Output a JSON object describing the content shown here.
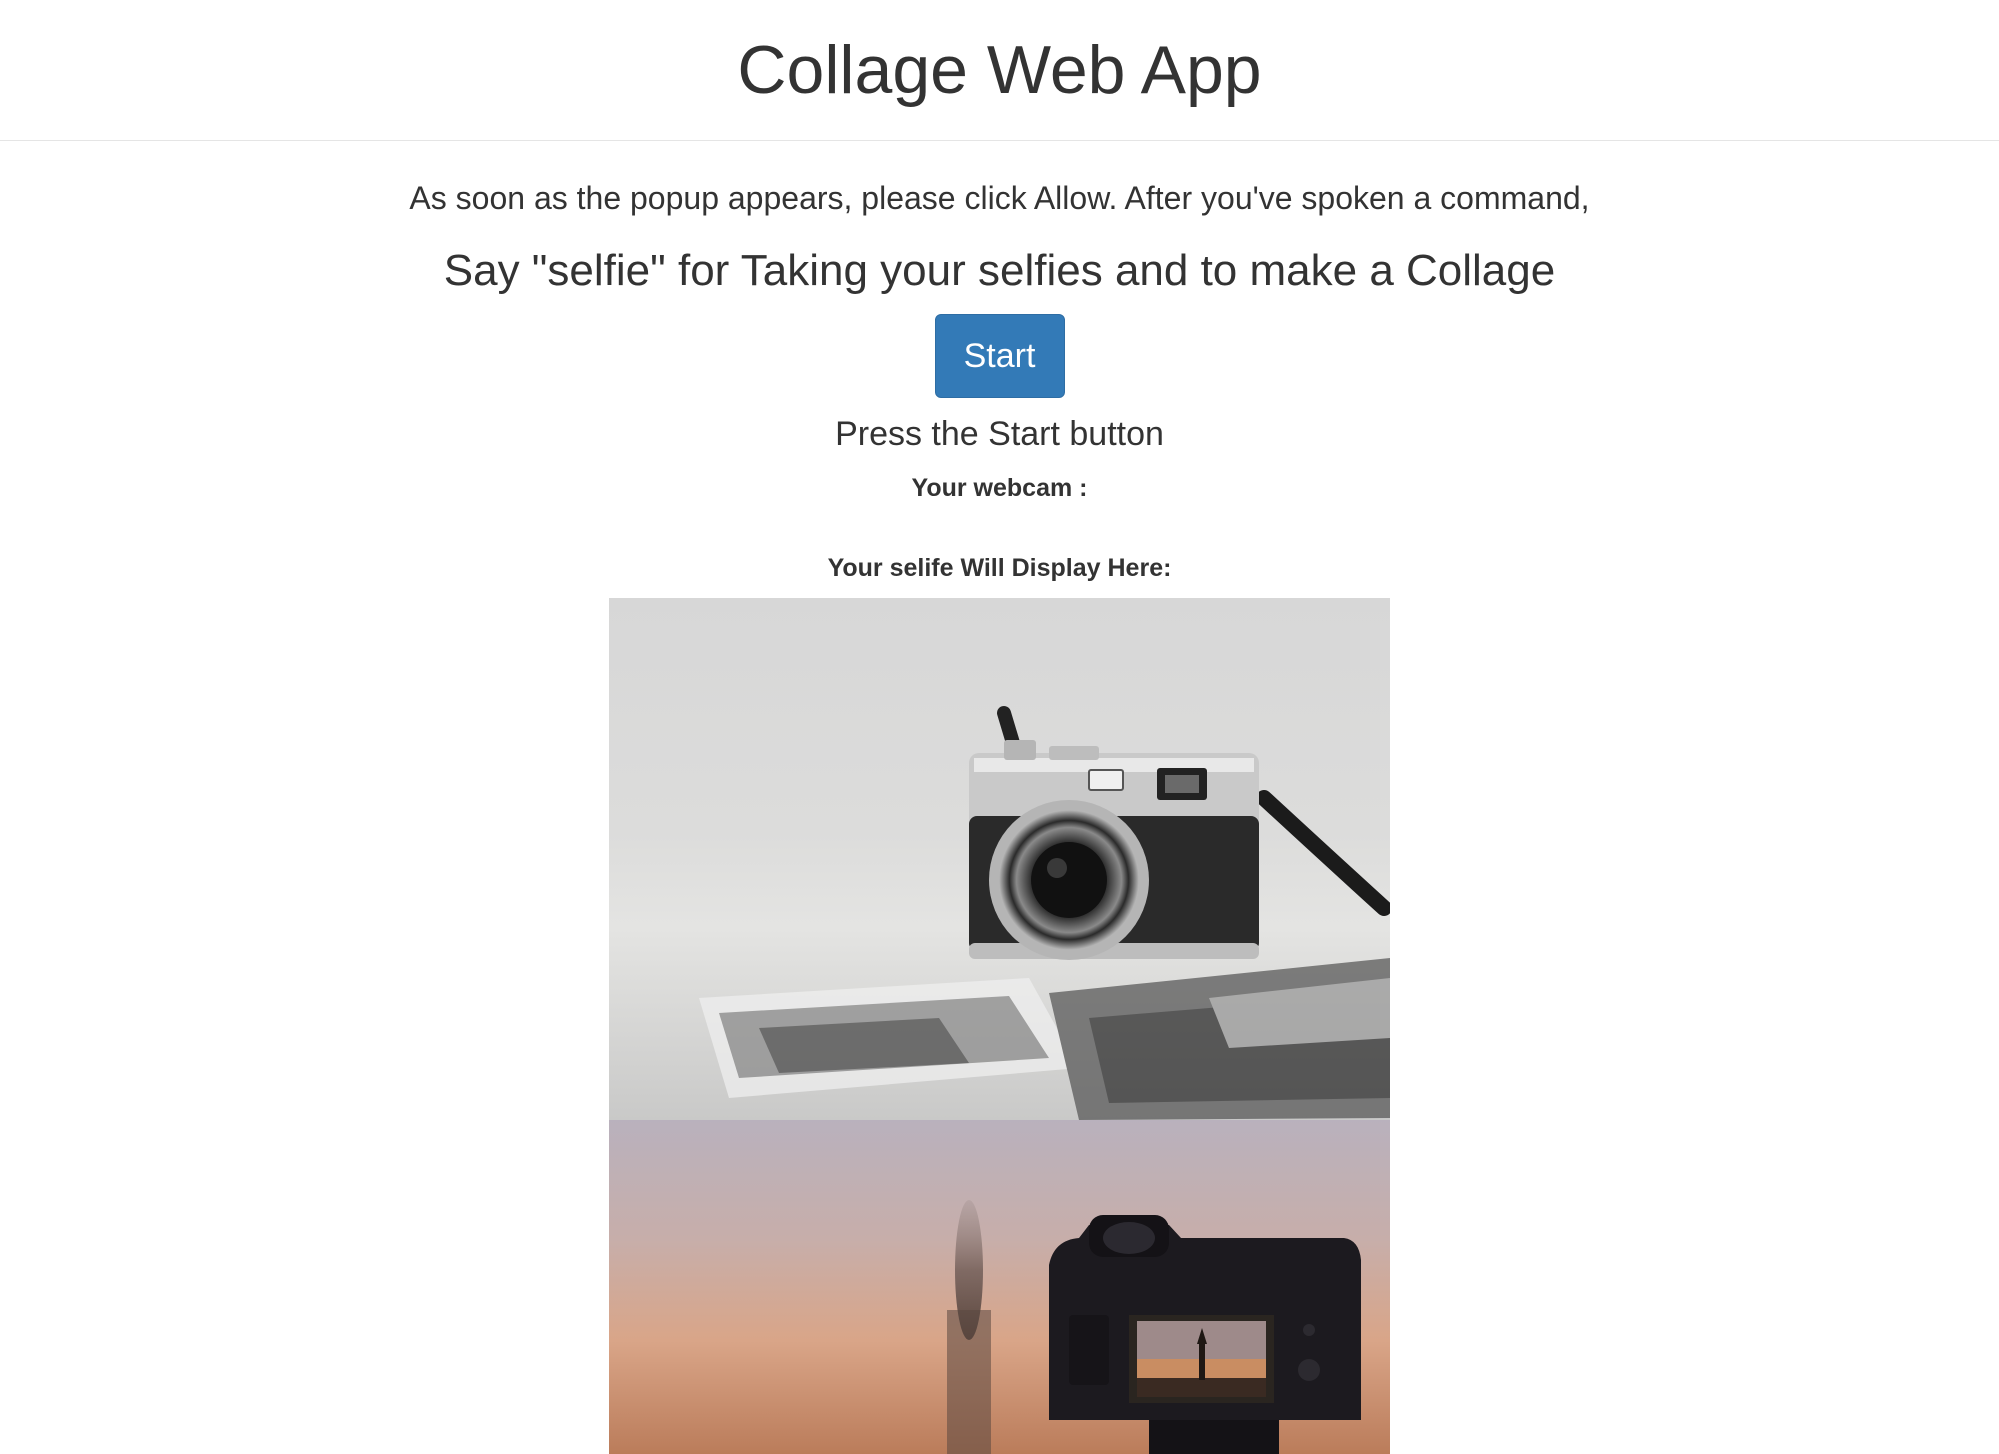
{
  "header": {
    "title": "Collage Web App"
  },
  "main": {
    "intro": "As soon as the popup appears, please click Allow. After you've spoken a command,",
    "instruction": "Say \"selfie\" for Taking your selfies and to make a Collage",
    "start_button_label": "Start",
    "status": "Press the Start button",
    "webcam_label": "Your webcam :",
    "selfie_label": "Your selife Will Display Here:"
  },
  "collage": {
    "photos": [
      {
        "name": "rangefinder-camera-photo",
        "subject": "silver rangefinder camera on table with black and white prints"
      },
      {
        "name": "dslr-sunset-photo",
        "subject": "camera on tripod at sunset with tower on screen"
      }
    ]
  },
  "colors": {
    "primary_button": "#337ab7",
    "text": "#333333",
    "header_border": "#e5e5e5"
  }
}
